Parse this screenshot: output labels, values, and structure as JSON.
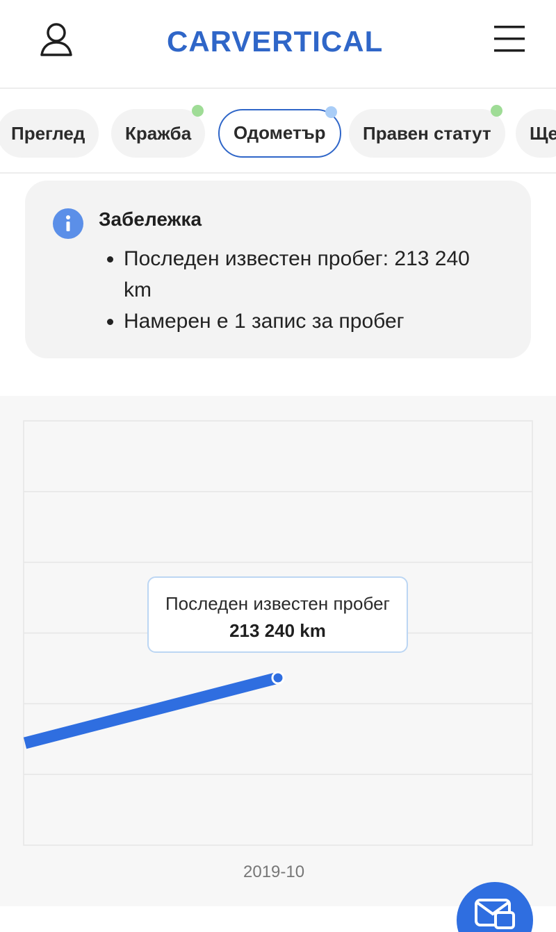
{
  "header": {
    "brand": "CARVERTICAL",
    "user_icon": "user-icon",
    "menu_icon": "hamburger-menu-icon"
  },
  "tabs": [
    {
      "label": "Преглед",
      "active": false,
      "indicator": ""
    },
    {
      "label": "Кражба",
      "active": false,
      "indicator": "green"
    },
    {
      "label": "Одометър",
      "active": true,
      "indicator": "blue"
    },
    {
      "label": "Правен статут",
      "active": false,
      "indicator": "green"
    },
    {
      "label": "Ще",
      "active": false,
      "indicator": ""
    }
  ],
  "note": {
    "icon": "info-icon",
    "title": "Забележка",
    "items": [
      "Последен известен пробег: 213 240 km",
      "Намерен е 1 запис за пробег"
    ]
  },
  "chart": {
    "tooltip_label": "Последен известен пробег",
    "tooltip_value": "213 240 km"
  },
  "chart_data": {
    "type": "line",
    "x": [
      "2019-10"
    ],
    "series": [
      {
        "values": [
          213240
        ]
      }
    ],
    "x_tick_labels": [
      "2019-10"
    ],
    "grid": true
  },
  "colors": {
    "brand": "#2f66c8",
    "line": "#2f6ee0",
    "dot_green": "#9fdc96",
    "dot_blue": "#a9cdf7"
  },
  "fab": {
    "icon": "chat-envelope-icon"
  }
}
